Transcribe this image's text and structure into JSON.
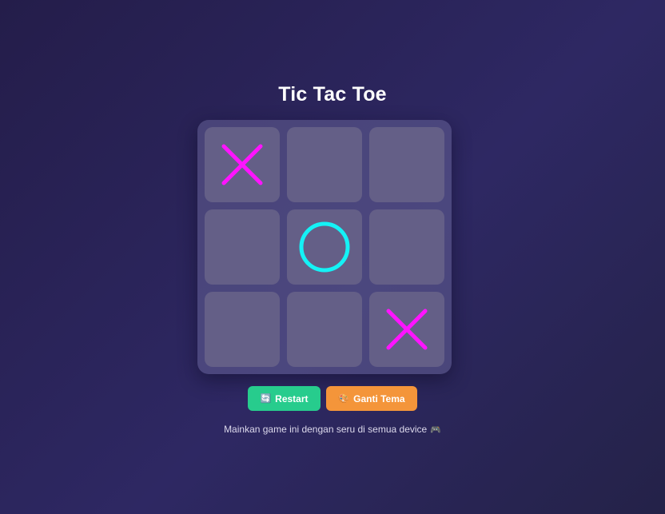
{
  "game": {
    "title": "Tic Tac Toe",
    "board": [
      [
        "X",
        "",
        ""
      ],
      [
        "",
        "O",
        ""
      ],
      [
        "",
        "",
        "X"
      ]
    ]
  },
  "controls": {
    "restart_icon": "🔄",
    "restart_label": "Restart",
    "theme_icon": "🎨",
    "theme_label": "Ganti Tema"
  },
  "footer": {
    "text": "Mainkan game ini dengan seru di semua device",
    "emoji": "🎮"
  },
  "colors": {
    "x_mark": "#ff14ff",
    "o_mark": "#14f2f6",
    "restart_button": "#27cc8d",
    "theme_button": "#f4953a"
  },
  "icons": {
    "restart": "restart-icon",
    "theme": "palette-icon",
    "footer": "gamepad-icon"
  }
}
